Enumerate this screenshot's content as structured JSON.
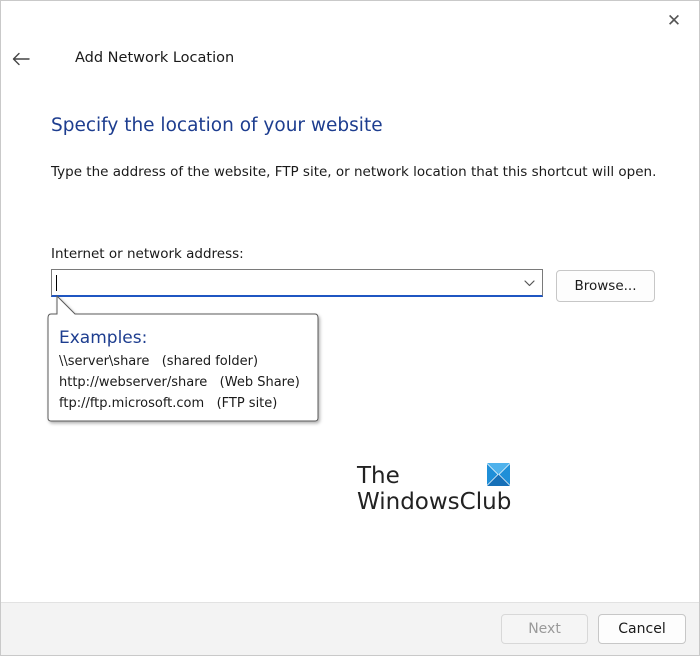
{
  "window": {
    "title": "Add Network Location",
    "close_glyph": "✕"
  },
  "page": {
    "heading": "Specify the location of your website",
    "description": "Type the address of the website, FTP site, or network location that this shortcut will open."
  },
  "address_field": {
    "label": "Internet or network address:",
    "value": "",
    "placeholder": ""
  },
  "browse_button": {
    "label": "Browse..."
  },
  "examples_tooltip": {
    "title": "Examples:",
    "lines": [
      "\\\\server\\share   (shared folder)",
      "http://webserver/share   (Web Share)",
      "ftp://ftp.microsoft.com   (FTP site)"
    ]
  },
  "watermark": {
    "line1": "The",
    "line2": "WindowsClub"
  },
  "footer": {
    "next_label": "Next",
    "cancel_label": "Cancel"
  },
  "colors": {
    "heading_blue": "#1d3d8f",
    "focus_blue": "#1f56c2",
    "logo_blue": "#1f8fd8",
    "footer_bg": "#f3f3f3"
  },
  "icons": {
    "back": "back-arrow-icon",
    "close": "close-icon",
    "dropdown": "chevron-down-icon",
    "logo": "windows-logo-icon"
  }
}
